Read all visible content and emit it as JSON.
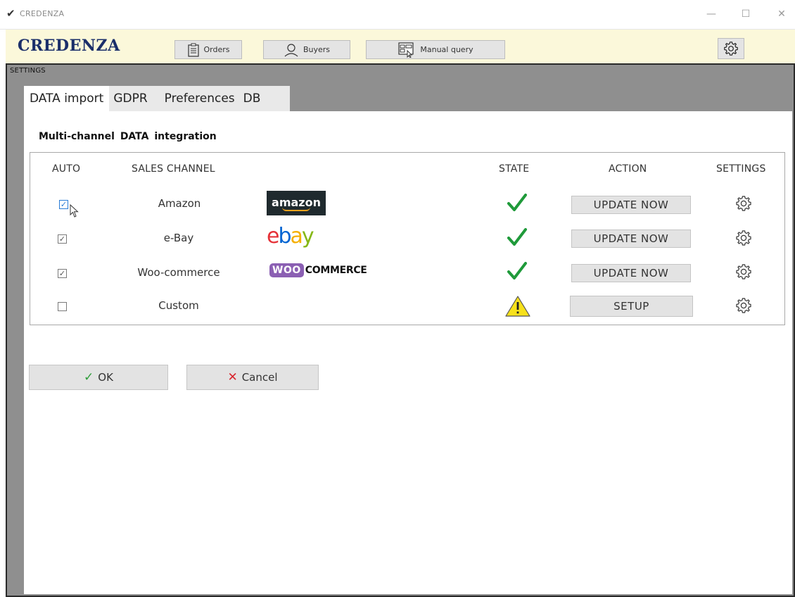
{
  "window": {
    "title": "CREDENZA",
    "title_icon": "checkmark-icon",
    "controls": {
      "minimize": "—",
      "maximize": "☐",
      "close": "✕"
    }
  },
  "header": {
    "brand": "CREDENZA",
    "buttons": [
      {
        "label": "Orders",
        "icon": "clipboard-list-icon"
      },
      {
        "label": "Buyers",
        "icon": "user-icon"
      },
      {
        "label": "Manual query",
        "icon": "query-form-icon"
      }
    ],
    "settings_icon": "gear-icon"
  },
  "settings": {
    "label": "SETTINGS",
    "tabs": [
      {
        "label": "DATA import",
        "active": true
      },
      {
        "label": "GDPR"
      },
      {
        "label": "Preferences"
      },
      {
        "label": "DB"
      }
    ],
    "section_title": "Multi-channel  DATA integration",
    "columns": {
      "auto": "AUTO",
      "sales_channel": "SALES CHANNEL",
      "state": "STATE",
      "action": "ACTION",
      "settings": "SETTINGS"
    },
    "channels": [
      {
        "name": "Amazon",
        "auto": true,
        "logo": "amazon",
        "state": "ok",
        "action": "UPDATE  NOW"
      },
      {
        "name": "e-Bay",
        "auto": true,
        "logo": "ebay",
        "state": "ok",
        "action": "UPDATE  NOW"
      },
      {
        "name": "Woo-commerce",
        "auto": true,
        "logo": "woocommerce",
        "state": "ok",
        "action": "UPDATE  NOW"
      },
      {
        "name": "Custom",
        "auto": false,
        "logo": "",
        "state": "warning",
        "action": "SETUP"
      }
    ],
    "logos": {
      "amazon": "amazon",
      "ebay": [
        "e",
        "b",
        "a",
        "y"
      ],
      "woo": "WOO",
      "commerce": "COMMERCE"
    },
    "buttons": {
      "ok": "OK",
      "cancel": "Cancel"
    },
    "colors": {
      "ok_green": "#2e9e3a",
      "cancel_red": "#d9262e",
      "brand_navy": "#1b2f6a",
      "header_bg": "#fbf8da",
      "warning_yellow": "#f7e11b"
    }
  }
}
